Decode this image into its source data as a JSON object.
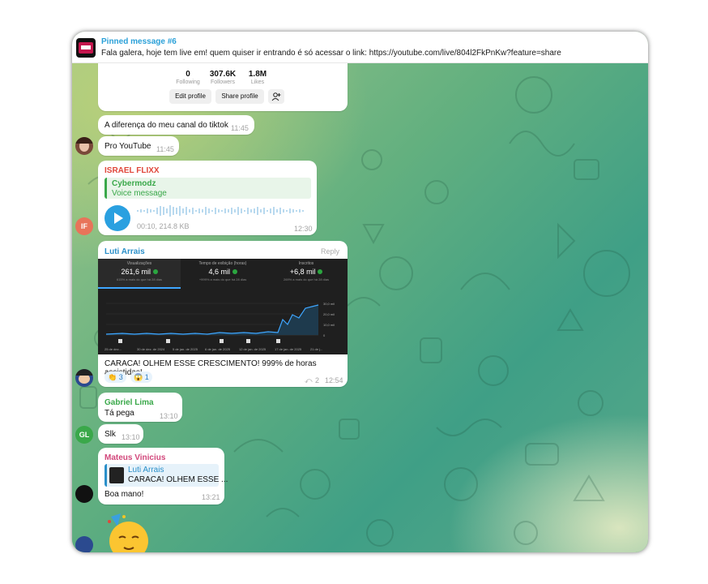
{
  "pinned": {
    "title": "Pinned message #6",
    "text": "Fala galera, hoje tem live em! quem quiser ir entrando é só acessar o link: https://youtube.com/live/804l2FkPnKw?feature=share"
  },
  "profile_card": {
    "stats": [
      {
        "num": "0",
        "label": "Following"
      },
      {
        "num": "307.6K",
        "label": "Followers"
      },
      {
        "num": "1.8M",
        "label": "Likes"
      }
    ],
    "edit_label": "Edit profile",
    "share_label": "Share profile"
  },
  "messages": {
    "m1": {
      "text": "A diferença do meu canal do tiktok",
      "time": "11:45"
    },
    "m2": {
      "text": "Pro YouTube",
      "time": "11:45"
    },
    "voice": {
      "sender": "ISRAEL FLIXX",
      "reply_name": "Cybermodz",
      "reply_text": "Voice message",
      "meta": "00:10, 214.8 KB",
      "time": "12:30",
      "avatar_initials": "IF"
    },
    "luti": {
      "sender": "Luti Arrais",
      "reply_label": "Reply",
      "caption": "CARACA! OLHEM ESSE CRESCIMENTO! 999% de horas assistidas!",
      "reactions": [
        {
          "emoji": "👏",
          "count": "3"
        },
        {
          "emoji": "😱",
          "count": "1"
        }
      ],
      "forwards": "2",
      "time": "12:54"
    },
    "gabriel": {
      "sender": "Gabriel Lima",
      "text": "Tá pega",
      "time": "13:10"
    },
    "slk": {
      "text": "Slk",
      "time": "13:10",
      "avatar_initials": "GL"
    },
    "mateus": {
      "sender": "Mateus Vinicius",
      "reply_name": "Luti Arrais",
      "reply_text": "CARACA! OLHEM ESSE ...",
      "text": "Boa mano!",
      "time": "13:21"
    }
  },
  "analytics": {
    "metrics": [
      {
        "label": "Visualizações",
        "value": "261,6 mil",
        "sub": "615% a mais do que há 28 dias"
      },
      {
        "label": "Tempo de exibição (horas)",
        "value": "4,6 mil",
        "sub": "+999% a mais do que há 28 dias"
      },
      {
        "label": "Inscritos",
        "value": "+6,8 mil",
        "sub": "269% a mais do que há 28 dias"
      }
    ],
    "y_ticks": [
      "30,0 mil",
      "20,0 mil",
      "10,0 mil",
      "0"
    ],
    "x_ticks": [
      "25 de dez...",
      "30 de dez. de 2024",
      "5 de jan. de 2025",
      "6 de jan. de 2025",
      "12 de jan. de 2025",
      "17 de jan. de 2025",
      "21 de j..."
    ]
  },
  "colors": {
    "sender_israel": "#e0473b",
    "sender_luti": "#2a8fc9",
    "sender_gabriel": "#3aa84a",
    "sender_mateus": "#d2477b",
    "reply_green": "#3aa84a",
    "reply_blue": "#2a8fc9",
    "play_button": "#2aa0e0"
  }
}
